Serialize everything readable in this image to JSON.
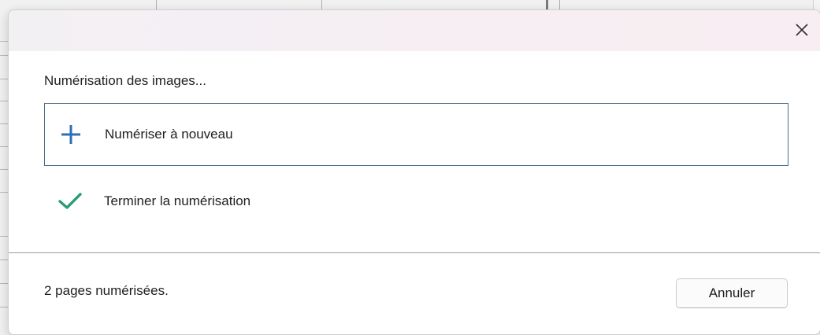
{
  "dialog": {
    "status_text": "Numérisation des images...",
    "options": [
      {
        "label": "Numériser à nouveau",
        "icon": "plus-icon",
        "selected": true
      },
      {
        "label": "Terminer la numérisation",
        "icon": "check-icon",
        "selected": false
      }
    ],
    "footer_text": "2 pages numérisées.",
    "cancel_label": "Annuler",
    "close_icon": "close-icon"
  },
  "colors": {
    "accent_plus": "#2e6fb8",
    "accent_check": "#2a9d73",
    "selected_border": "#4a6d8c",
    "titlebar": "#f5eff3"
  }
}
